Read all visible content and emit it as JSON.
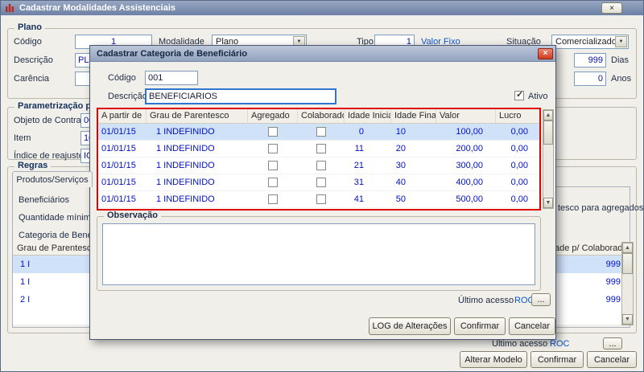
{
  "icons": {
    "dropdown": "▼",
    "scroll_up": "▲",
    "scroll_down": "▼",
    "close": "×",
    "window_box": "×",
    "check": "✓",
    "ellipsis": "..."
  },
  "main": {
    "title": "Cadastrar Modalidades Assistenciais",
    "plano": {
      "legend": "Plano",
      "codigo_label": "Código",
      "codigo_value": "1",
      "modalidade_label": "Modalidade",
      "modalidade_value": "Plano",
      "tipo_label": "Tipo",
      "tipo_value": "1",
      "tipo_desc": "Valor Fixo",
      "situacao_label": "Situação",
      "situacao_value": "Comercializado",
      "descricao_label": "Descrição",
      "descricao_value": "PL",
      "dias_value": "999",
      "dias_label": "Dias",
      "carencia_label": "Carência",
      "carencia_value": "",
      "anos_value": "0",
      "anos_label": "Anos"
    },
    "parametrizacao": {
      "legend": "Parametrização par",
      "objeto_label": "Objeto de Contrato",
      "objeto_value": "00",
      "item_label": "Item",
      "item_value": "10.",
      "indice_label": "Índice de reajuste",
      "indice_value": "IGP"
    },
    "regras": {
      "legend": "Regras",
      "tab_label": "Produtos/Serviços",
      "beneficiarios_label": "Beneficiários",
      "quantidade_label": "Quantidade mínima",
      "categoria_label": "Categoria de Benefici",
      "agregados_fragment": "tesco para agregados",
      "grid_left_header": "Grau de Parentesco",
      "grid_right_header": "ade p/ Colaborador",
      "rows": [
        {
          "left": "1 I",
          "right": "999"
        },
        {
          "left": "1 I",
          "right": "999"
        },
        {
          "left": "2 I",
          "right": "999"
        }
      ]
    },
    "ultimo_acesso_label": "Último acesso",
    "ultimo_acesso_value": "ROC",
    "buttons": {
      "alterar": "Alterar Modelo",
      "confirmar": "Confirmar",
      "cancelar": "Cancelar"
    }
  },
  "dialog": {
    "title": "Cadastrar Categoria de Beneficiário",
    "codigo_label": "Código",
    "codigo_value": "001",
    "descricao_label": "Descrição",
    "descricao_value": "BENEFICIARIOS",
    "ativo_label": "Ativo",
    "grid": {
      "columns": [
        "A partir de",
        "Grau de Parentesco",
        "Agregado",
        "Colaborador",
        "Idade Inicial",
        "Idade Final",
        "Valor",
        "Lucro"
      ],
      "rows": [
        {
          "data": "01/01/15",
          "grau": "1 INDEFINIDO",
          "inicial": "0",
          "final": "10",
          "valor": "100,00",
          "lucro": "0,00"
        },
        {
          "data": "01/01/15",
          "grau": "1 INDEFINIDO",
          "inicial": "11",
          "final": "20",
          "valor": "200,00",
          "lucro": "0,00"
        },
        {
          "data": "01/01/15",
          "grau": "1 INDEFINIDO",
          "inicial": "21",
          "final": "30",
          "valor": "300,00",
          "lucro": "0,00"
        },
        {
          "data": "01/01/15",
          "grau": "1 INDEFINIDO",
          "inicial": "31",
          "final": "40",
          "valor": "400,00",
          "lucro": "0,00"
        },
        {
          "data": "01/01/15",
          "grau": "1 INDEFINIDO",
          "inicial": "41",
          "final": "50",
          "valor": "500,00",
          "lucro": "0,00"
        }
      ]
    },
    "observacao_legend": "Observação",
    "ultimo_acesso_label": "Último acesso",
    "ultimo_acesso_value": "ROC",
    "buttons": {
      "log": "LOG de Alterações",
      "confirmar": "Confirmar",
      "cancelar": "Cancelar"
    }
  }
}
